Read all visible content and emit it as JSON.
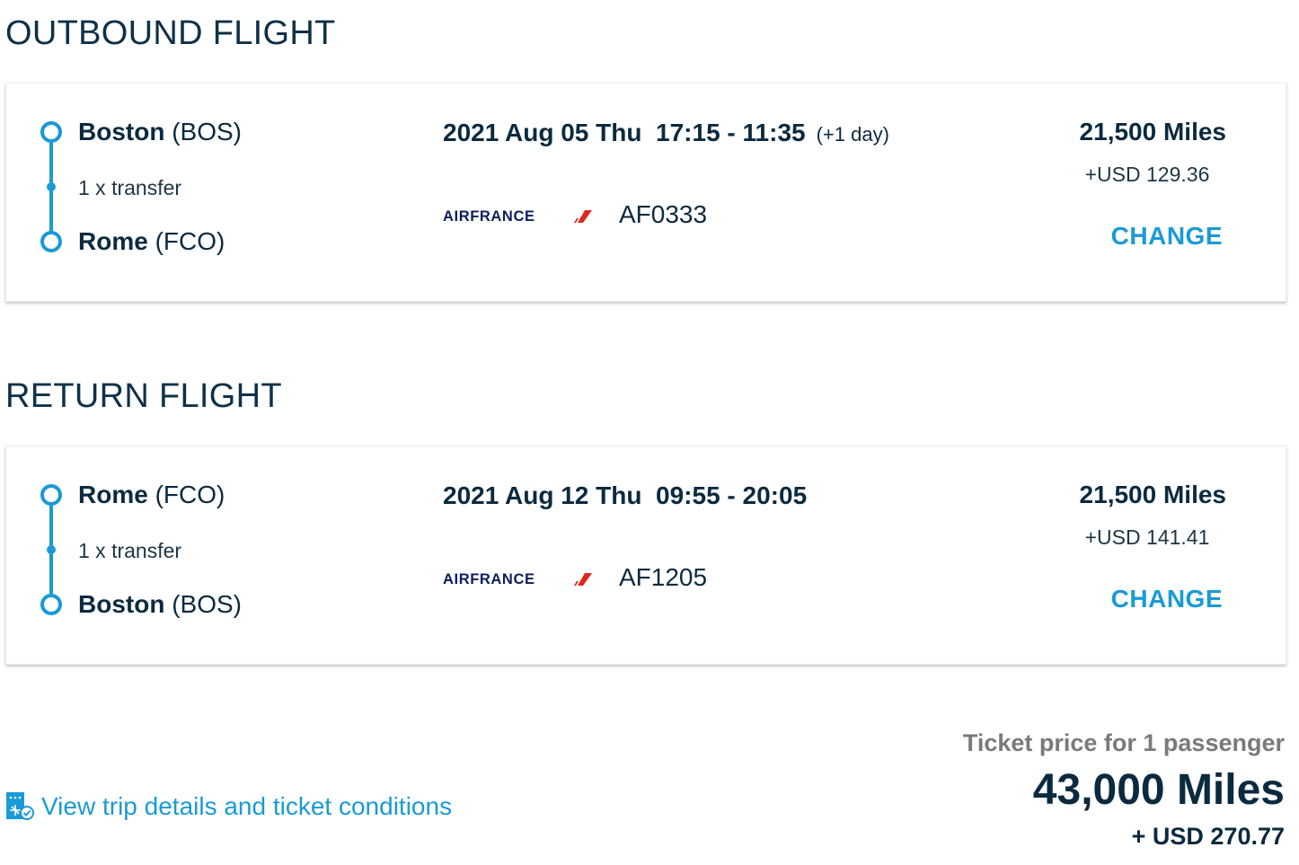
{
  "outbound": {
    "heading": "OUTBOUND FLIGHT",
    "origin_city": "Boston",
    "origin_code": "(BOS)",
    "transfer": "1 x transfer",
    "destination_city": "Rome",
    "destination_code": "(FCO)",
    "datetime": "2021 Aug 05 Thu  17:15 - 11:35",
    "plus_day": "(+1 day)",
    "airline": "AIRFRANCE",
    "flight_number": "AF0333",
    "miles": "21,500 Miles",
    "usd": "+USD 129.36",
    "change_label": "CHANGE"
  },
  "return": {
    "heading": "RETURN FLIGHT",
    "origin_city": "Rome",
    "origin_code": "(FCO)",
    "transfer": "1 x transfer",
    "destination_city": "Boston",
    "destination_code": "(BOS)",
    "datetime": "2021 Aug 12 Thu  09:55 - 20:05",
    "airline": "AIRFRANCE",
    "flight_number": "AF1205",
    "miles": "21,500 Miles",
    "usd": "+USD 141.41",
    "change_label": "CHANGE"
  },
  "footer": {
    "details_link": "View trip details and ticket conditions",
    "details_icon": "ticket-conditions-icon",
    "price_label": "Ticket price for 1 passenger",
    "total_miles": "43,000 Miles",
    "total_usd": "+ USD 270.77"
  },
  "colors": {
    "accent": "#1a9ad6",
    "text_dark": "#0b2a3f",
    "airline_navy": "#0b1f5c",
    "airline_red": "#e1261c"
  }
}
